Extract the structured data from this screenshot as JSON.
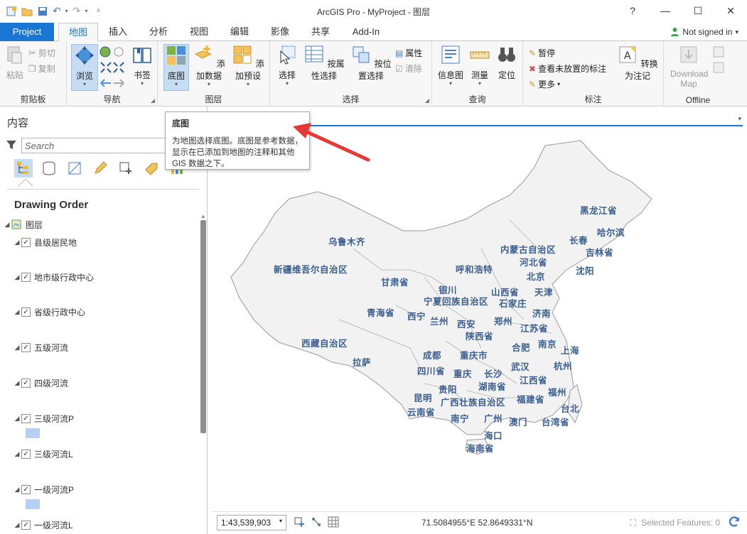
{
  "window": {
    "title": "ArcGIS Pro - MyProject - 图层",
    "help": "?",
    "minimize": "—",
    "maximize": "☐",
    "close": "✕"
  },
  "tabs": {
    "project": "Project",
    "items": [
      "地图",
      "插入",
      "分析",
      "视图",
      "编辑",
      "影像",
      "共享",
      "Add-In"
    ],
    "active": "地图"
  },
  "account": {
    "status": "Not signed in",
    "caret": "▾"
  },
  "ribbon": {
    "clipboard": {
      "label": "剪贴板",
      "paste": "粘贴",
      "cut": "剪切",
      "copy": "复制"
    },
    "navigate": {
      "label": "导航",
      "explore": "浏览",
      "bookmarks": "书签"
    },
    "layer": {
      "label": "图层",
      "basemap": "底图",
      "add_data": "添加数据",
      "add_preset": "添加预设"
    },
    "selection": {
      "label": "选择",
      "select": "选择",
      "by_attribute": "按属性选择",
      "by_location": "按位置选择",
      "attributes": "属性",
      "clear": "清除"
    },
    "inquiry": {
      "label": "查询",
      "infographics": "信息图",
      "measure": "测量",
      "locate": "定位"
    },
    "labeling": {
      "label": "标注",
      "pause": "暂停",
      "view_unplaced": "查看未放置的标注",
      "more": "更多",
      "convert": "转换为注记"
    },
    "offline": {
      "label": "Offline",
      "download_map": "Download Map"
    }
  },
  "contents": {
    "title": "内容",
    "search_placeholder": "Search",
    "drawing_order": "Drawing Order",
    "map_name": "图层",
    "layers": [
      "县级居民地",
      "地市级行政中心",
      "省级行政中心",
      "五级河流",
      "四级河流",
      "三级河流P",
      "三级河流L",
      "一级河流P",
      "一级河流L"
    ]
  },
  "tooltip": {
    "title": "底图",
    "body": "为地图选择底图。底图是参考数据，显示在已添加到地图的注释和其他 GIS 数据之下。"
  },
  "map": {
    "labels": [
      "黑龙江省",
      "哈尔滨",
      "长春",
      "吉林省",
      "沈阳",
      "内蒙古自治区",
      "乌鲁木齐",
      "新疆维吾尔自治区",
      "甘肃省",
      "呼和浩特",
      "河北省",
      "北京",
      "天津",
      "银川",
      "山西省",
      "石家庄",
      "宁夏回族自治区",
      "青海省",
      "西宁",
      "兰州",
      "西安",
      "郑州",
      "济南",
      "陕西省",
      "江苏省",
      "西藏自治区",
      "合肥",
      "南京",
      "上海",
      "成都",
      "重庆市",
      "拉萨",
      "四川省",
      "武汉",
      "杭州",
      "重庆",
      "长沙",
      "湖南省",
      "江西省",
      "贵阳",
      "福州",
      "昆明",
      "广西壮族自治区",
      "福建省",
      "云南省",
      "南宁",
      "广州",
      "澳门",
      "台北",
      "台湾省",
      "海口",
      "海南省"
    ]
  },
  "statusbar": {
    "scale": "1:43,539,903",
    "coordinates": "71.5084955°E 52.8649331°N",
    "selected_features": "Selected Features: 0"
  },
  "colors": {
    "accent": "#1976d2",
    "map_label": "#3a5f8f",
    "land": "#f2f2f2"
  }
}
